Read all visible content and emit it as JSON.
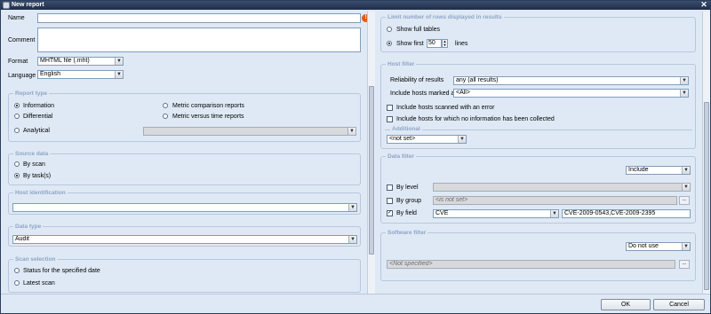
{
  "window": {
    "title": "New report"
  },
  "left": {
    "name_label": "Name",
    "comment_label": "Comment",
    "format_label": "Format",
    "format_value": "MHTML file (.mht)",
    "language_label": "Language",
    "language_value": "English",
    "report_type": {
      "title": "Report type",
      "options": [
        "Information",
        "Differential",
        "Metric comparison reports",
        "Metric versus time reports",
        "Analytical"
      ],
      "selected": "Information"
    },
    "source_data": {
      "title": "Source data",
      "options": [
        "By scan",
        "By task(s)"
      ],
      "selected": "By task(s)"
    },
    "host_identification": {
      "title": "Host identification"
    },
    "data_type": {
      "title": "Data type",
      "value": "Audit"
    },
    "scan_selection": {
      "title": "Scan selection",
      "options": [
        "Status for the specified date",
        "Latest scan"
      ]
    }
  },
  "right": {
    "limit_rows": {
      "title": "Limit number of rows displayed in results",
      "show_full": "Show full tables",
      "show_first": "Show first",
      "count": "50",
      "lines": "lines"
    },
    "host_filter": {
      "title": "Host filter",
      "reliability_label": "Reliability of results",
      "reliability_value": "any (all results)",
      "include_marked_label": "Include hosts marked as",
      "include_marked_value": "<All>",
      "scanned_error": "Include hosts scanned with an error",
      "no_info": "Include hosts for which no information has been collected",
      "additional_title": "Additional",
      "additional_value": "<not set>"
    },
    "data_filter": {
      "title": "Data filter",
      "mode_value": "Include",
      "by_level": "By level",
      "by_group": "By group",
      "group_placeholder": "<is not set>",
      "by_field": "By field",
      "field_value": "CVE",
      "field_text": "CVE-2009-0543,CVE-2009-2395"
    },
    "software_filter": {
      "title": "Software filter",
      "mode_value": "Do not use",
      "placeholder": "<Not specified>"
    }
  },
  "footer": {
    "ok": "OK",
    "cancel": "Cancel"
  },
  "colors": {
    "accent": "#8ea4c6",
    "titlebar": "#1f2d47",
    "warning": "#e15a19"
  }
}
